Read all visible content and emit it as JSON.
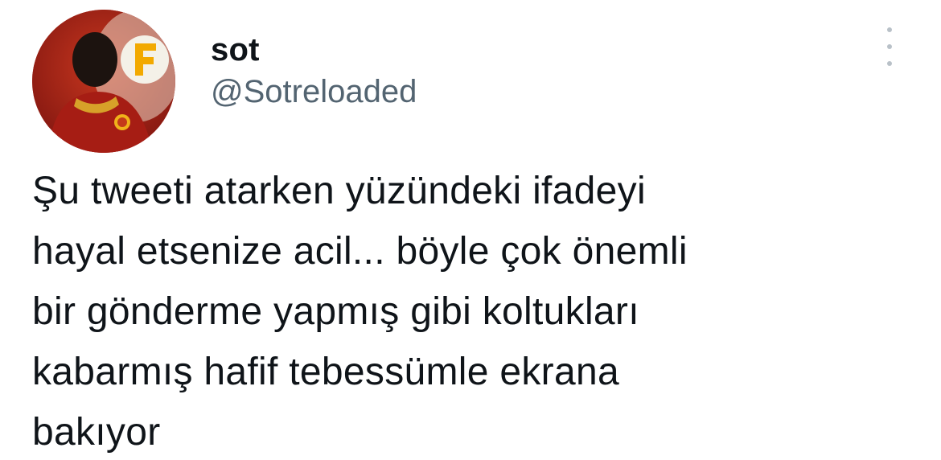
{
  "user": {
    "display_name": "sot",
    "handle": "@Sotreloaded"
  },
  "tweet": {
    "text": "Şu tweeti atarken yüzündeki ifadeyi\nhayal etsenize acil... böyle çok önemli\nbir gönderme yapmış gibi koltukları\nkabarmış hafif tebessümle ekrana\nbakıyor"
  },
  "icons": {
    "more": "more-options-icon",
    "avatar": "profile-photo"
  },
  "colors": {
    "text": "#0f1419",
    "secondary_text": "#536471",
    "background": "#ffffff",
    "avatar_accent": "#b52318"
  }
}
